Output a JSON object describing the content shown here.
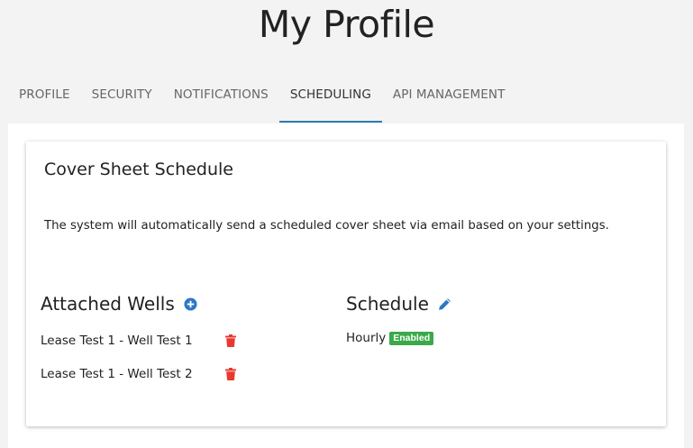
{
  "page": {
    "title": "My Profile"
  },
  "tabs": [
    {
      "label": "PROFILE"
    },
    {
      "label": "SECURITY"
    },
    {
      "label": "NOTIFICATIONS"
    },
    {
      "label": "SCHEDULING"
    },
    {
      "label": "API MANAGEMENT"
    }
  ],
  "active_tab": "SCHEDULING",
  "card": {
    "title": "Cover Sheet Schedule",
    "description": "The system will automatically send a scheduled cover sheet via email based on your settings."
  },
  "attached_wells": {
    "heading": "Attached Wells",
    "add_icon": "plus-circle-icon",
    "items": [
      {
        "label": "Lease Test 1 - Well Test 1",
        "delete_icon": "trash-icon"
      },
      {
        "label": "Lease Test 1 - Well Test 2",
        "delete_icon": "trash-icon"
      }
    ]
  },
  "schedule": {
    "heading": "Schedule",
    "edit_icon": "pencil-icon",
    "frequency": "Hourly",
    "status_badge": "Enabled"
  },
  "colors": {
    "accent": "#2c7cb0",
    "add_icon": "#2b78c5",
    "edit_icon": "#2b78c5",
    "delete_icon": "#e8392f",
    "badge_bg": "#3aa94a",
    "page_bg": "#f3f3f3"
  }
}
